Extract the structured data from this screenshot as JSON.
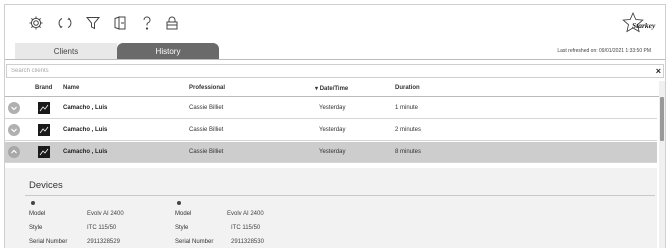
{
  "toolbar": {
    "icons": [
      "settings-icon",
      "sync-icon",
      "filter-icon",
      "exit-icon",
      "help-icon",
      "lock-icon"
    ]
  },
  "brand_logo": {
    "text": "Starkey"
  },
  "tabs": [
    {
      "label": "Clients",
      "active": false
    },
    {
      "label": "History",
      "active": true
    }
  ],
  "last_refreshed": "Last refreshed on: 09/01/2021 1:33:50 PM",
  "search": {
    "placeholder": "Search clients",
    "value": "",
    "clear_label": "×"
  },
  "table": {
    "columns": {
      "brand": "Brand",
      "name": "Name",
      "professional": "Professional",
      "datetime": "Date/Time",
      "duration": "Duration"
    },
    "rows": [
      {
        "name": "Camacho , Luis",
        "professional": "Cassie Billiet",
        "datetime": "Yesterday",
        "duration": "1 minute",
        "expanded": false
      },
      {
        "name": "Camacho , Luis",
        "professional": "Cassie Billiet",
        "datetime": "Yesterday",
        "duration": "2 minutes",
        "expanded": false
      },
      {
        "name": "Camacho , Luis",
        "professional": "Cassie Billiet",
        "datetime": "Yesterday",
        "duration": "8 minutes",
        "expanded": true
      }
    ]
  },
  "details": {
    "title": "Devices",
    "devices": [
      {
        "model_label": "Model",
        "model": "Evolv AI 2400",
        "style_label": "Style",
        "style": "ITC 115/50",
        "serial_label": "Serial Number",
        "serial": "2911328529"
      },
      {
        "model_label": "Model",
        "model": "Evolv AI 2400",
        "style_label": "Style",
        "style": "ITC 115/50",
        "serial_label": "Serial Number",
        "serial": "2911328530"
      }
    ]
  },
  "colors": {
    "active_tab": "#6a6a6a",
    "selected_row": "#cdcdcd",
    "details_bg": "#f2f2f2"
  }
}
